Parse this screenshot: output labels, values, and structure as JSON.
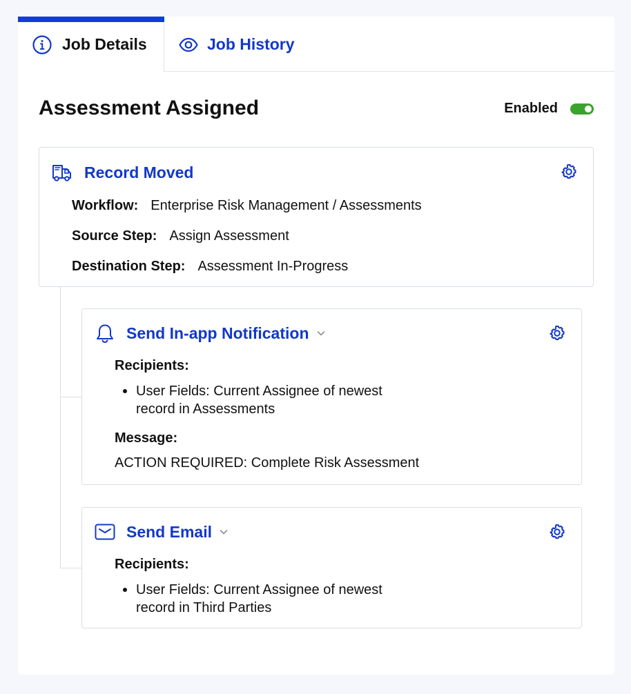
{
  "tabs": [
    {
      "label": "Job Details",
      "icon": "info-icon",
      "active": true
    },
    {
      "label": "Job History",
      "icon": "eye-icon",
      "active": false
    }
  ],
  "job": {
    "title": "Assessment Assigned",
    "status_label": "Enabled",
    "enabled": true
  },
  "trigger": {
    "title": "Record Moved",
    "icon": "truck-icon",
    "workflow_label": "Workflow:",
    "workflow_value": "Enterprise Risk Management / Assessments",
    "source_label": "Source Step:",
    "source_value": "Assign Assessment",
    "destination_label": "Destination Step:",
    "destination_value": "Assessment In-Progress"
  },
  "actions": [
    {
      "title": "Send In-app Notification",
      "icon": "bell-icon",
      "recipients_label": "Recipients:",
      "recipients_line1": "User Fields: Current Assignee of newest",
      "recipients_line2": "record in Assessments",
      "message_label": "Message:",
      "message_value": "ACTION REQUIRED: Complete Risk Assessment"
    },
    {
      "title": "Send Email",
      "icon": "envelope-icon",
      "recipients_label": "Recipients:",
      "recipients_line1": "User Fields: Current Assignee of newest",
      "recipients_line2": "record in Third Parties"
    }
  ],
  "colors": {
    "accent": "#1238c8",
    "tab_indicator": "#0d3fd4",
    "toggle_on": "#3aa42c"
  }
}
